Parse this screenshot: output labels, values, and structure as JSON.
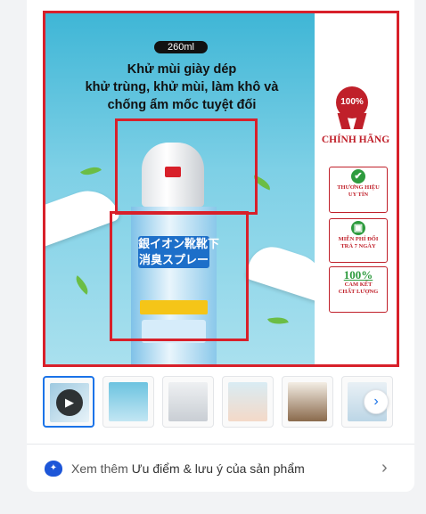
{
  "product_image": {
    "volume_label": "260ml",
    "headline_lines": [
      "Khử mùi giày dép",
      "khử trùng, khử mùi, làm khô và",
      "chống ẩm mốc tuyệt đối"
    ],
    "product_label_jp": [
      "銀イオン靴靴下",
      "消臭スプレー"
    ],
    "seal_text": "100%",
    "authentic_label": "CHÍNH HÃNG",
    "badges": [
      {
        "icon": "check-icon",
        "lines": [
          "THƯƠNG HIỆU",
          "UY TÍN"
        ]
      },
      {
        "icon": "gift-icon",
        "lines": [
          "MIỄN PHÍ ĐỔI",
          "TRẢ 7 NGÀY"
        ]
      },
      {
        "icon": "percent-icon",
        "percent": "100%",
        "lines": [
          "CAM KẾT",
          "CHẤT LƯỢNG"
        ]
      }
    ],
    "highlight_color": "#d8202a"
  },
  "thumbnails": {
    "count_visible": 6,
    "active_index": 0,
    "first_is_video": true,
    "next_icon": "chevron-right-icon"
  },
  "see_more": {
    "prefix": "Xem thêm",
    "text": "Ưu điểm & lưu ý của sản phẩm",
    "icon": "lightbulb-icon"
  },
  "colors": {
    "accent": "#1a73e8",
    "red": "#d8202a",
    "green": "#2e9b3e"
  }
}
